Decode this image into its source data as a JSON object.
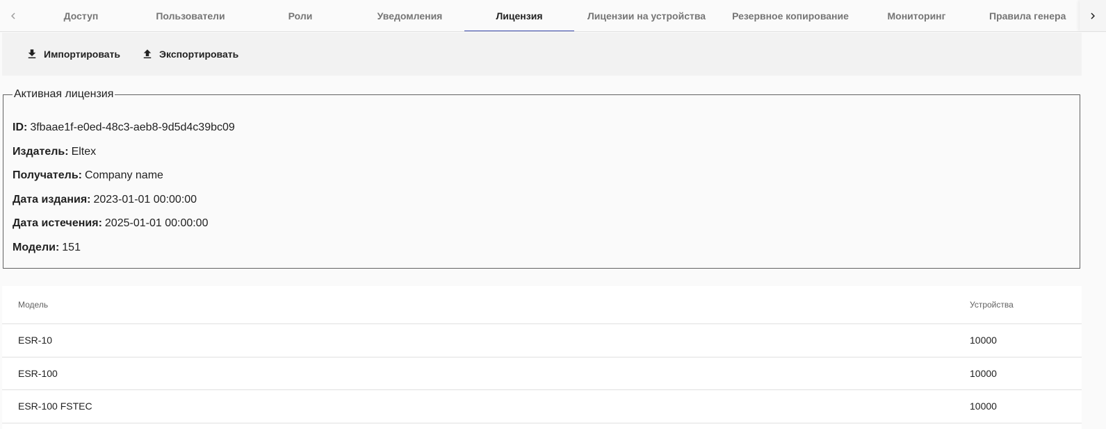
{
  "tabs": [
    {
      "label": "Доступ",
      "active": false
    },
    {
      "label": "Пользователи",
      "active": false
    },
    {
      "label": "Роли",
      "active": false
    },
    {
      "label": "Уведомления",
      "active": false
    },
    {
      "label": "Лицензия",
      "active": true
    },
    {
      "label": "Лицензии на устройства",
      "active": false
    },
    {
      "label": "Резервное копирование",
      "active": false
    },
    {
      "label": "Мониторинг",
      "active": false
    },
    {
      "label": "Правила генера",
      "active": false
    }
  ],
  "toolbar": {
    "import_label": "Импортировать",
    "export_label": "Экспортировать"
  },
  "license": {
    "legend": "Активная лицензия",
    "fields": [
      {
        "key": "ID:",
        "value": "3fbaae1f-e0ed-48c3-aeb8-9d5d4c39bc09"
      },
      {
        "key": "Издатель:",
        "value": "Eltex"
      },
      {
        "key": "Получатель:",
        "value": "Company name"
      },
      {
        "key": "Дата издания:",
        "value": "2023-01-01 00:00:00"
      },
      {
        "key": "Дата истечения:",
        "value": "2025-01-01 00:00:00"
      },
      {
        "key": "Модели:",
        "value": "151"
      }
    ]
  },
  "table": {
    "headers": {
      "model": "Модель",
      "devices": "Устройства"
    },
    "rows": [
      {
        "model": "ESR-10",
        "devices": "10000"
      },
      {
        "model": "ESR-100",
        "devices": "10000"
      },
      {
        "model": "ESR-100 FSTEC",
        "devices": "10000"
      }
    ]
  },
  "colors": {
    "accent": "#3949ab"
  }
}
